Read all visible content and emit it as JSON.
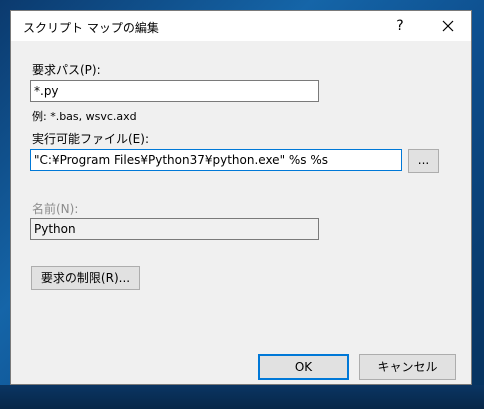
{
  "dialog": {
    "title": "スクリプト マップの編集",
    "help_label": "?",
    "request_path": {
      "label": "要求パス(P):",
      "value": "*.py",
      "example": "例: *.bas, wsvc.axd"
    },
    "executable": {
      "label": "実行可能ファイル(E):",
      "value": "\"C:¥Program Files¥Python37¥python.exe\" %s %s",
      "browse_label": "..."
    },
    "name": {
      "label": "名前(N):",
      "value": "Python"
    },
    "restrictions_button": "要求の制限(R)...",
    "ok_button": "OK",
    "cancel_button": "キャンセル"
  },
  "icons": {
    "close": "close-icon"
  }
}
